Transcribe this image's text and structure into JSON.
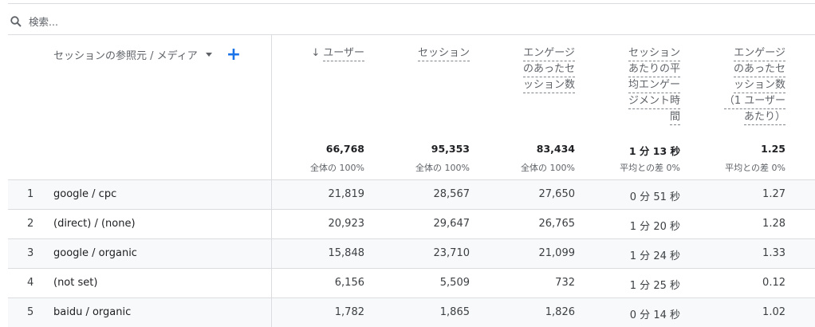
{
  "search": {
    "placeholder": "検索..."
  },
  "dimension": {
    "header": "セッションの参照元 / メディア",
    "add_symbol": "+"
  },
  "sort_arrow": "↓",
  "columns": [
    {
      "lines": [
        "ユーザー"
      ]
    },
    {
      "lines": [
        "セッション"
      ]
    },
    {
      "lines": [
        "エンゲージ",
        "のあったセ",
        "ッション数"
      ]
    },
    {
      "lines": [
        "セッション",
        "あたりの平",
        "均エンゲー",
        "ジメント時",
        "間"
      ]
    },
    {
      "lines": [
        "エンゲージ",
        "のあったセ",
        "ッション数",
        "（1 ユーザー",
        "あたり）"
      ]
    }
  ],
  "totals": [
    {
      "value": "66,768",
      "sub": "全体の 100%"
    },
    {
      "value": "95,353",
      "sub": "全体の 100%"
    },
    {
      "value": "83,434",
      "sub": "全体の 100%"
    },
    {
      "value": "1 分 13 秒",
      "sub": "平均との差 0%"
    },
    {
      "value": "1.25",
      "sub": "平均との差 0%"
    }
  ],
  "rows": [
    {
      "index": "1",
      "dimension": "google / cpc",
      "values": [
        "21,819",
        "28,567",
        "27,650",
        "0 分 51 秒",
        "1.27"
      ]
    },
    {
      "index": "2",
      "dimension": "(direct) / (none)",
      "values": [
        "20,923",
        "29,647",
        "26,765",
        "1 分 20 秒",
        "1.28"
      ]
    },
    {
      "index": "3",
      "dimension": "google / organic",
      "values": [
        "15,848",
        "23,710",
        "21,099",
        "1 分 24 秒",
        "1.33"
      ]
    },
    {
      "index": "4",
      "dimension": "(not set)",
      "values": [
        "6,156",
        "5,509",
        "732",
        "1 分 25 秒",
        "0.12"
      ]
    },
    {
      "index": "5",
      "dimension": "baidu / organic",
      "values": [
        "1,782",
        "1,865",
        "1,826",
        "0 分 14 秒",
        "1.02"
      ]
    }
  ]
}
